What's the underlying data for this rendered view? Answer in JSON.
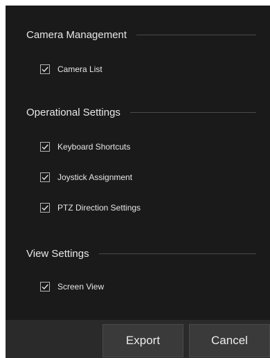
{
  "sections": [
    {
      "title": "Camera Management",
      "options": [
        {
          "label": "Camera List",
          "checked": true
        }
      ]
    },
    {
      "title": "Operational Settings",
      "options": [
        {
          "label": "Keyboard Shortcuts",
          "checked": true
        },
        {
          "label": "Joystick Assignment",
          "checked": true
        },
        {
          "label": "PTZ Direction Settings",
          "checked": true
        }
      ]
    },
    {
      "title": "View Settings",
      "options": [
        {
          "label": "Screen View",
          "checked": true
        }
      ]
    }
  ],
  "footer": {
    "export_label": "Export",
    "cancel_label": "Cancel"
  },
  "colors": {
    "dialog_background": "#1a1a1a",
    "footer_background": "#2a2a2a",
    "button_background": "#3a3a3a",
    "checkmark": "#e6e6e6"
  },
  "icons": {
    "checkbox_checked": "checkmark-icon"
  }
}
